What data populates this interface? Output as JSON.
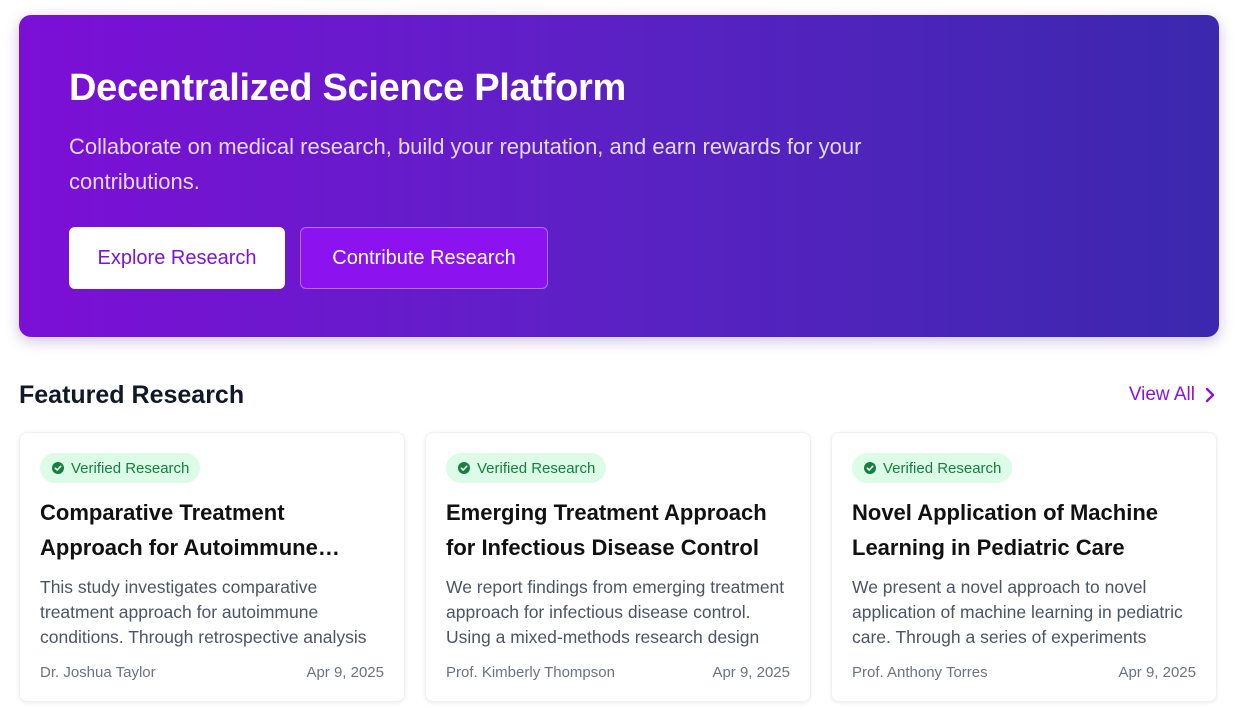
{
  "hero": {
    "title": "Decentralized Science Platform",
    "subtitle": "Collaborate on medical research, build your reputation, and earn rewards for your contributions.",
    "primary_button": "Explore Research",
    "secondary_button": "Contribute Research"
  },
  "featured": {
    "title": "Featured Research",
    "view_all": "View All",
    "view_all_icon": "chevron-right-icon",
    "cards": [
      {
        "badge": "Verified Research",
        "badge_icon": "check-circle-icon",
        "title": "Comparative Treatment Approach for Autoimmune Conditions",
        "description": "This study investigates comparative treatment approach for autoimmune conditions. Through retrospective analysis",
        "author": "Dr. Joshua Taylor",
        "date": "Apr 9, 2025"
      },
      {
        "badge": "Verified Research",
        "badge_icon": "check-circle-icon",
        "title": "Emerging Treatment Approach for Infectious Disease Control",
        "description": "We report findings from emerging treatment approach for infectious disease control. Using a mixed-methods research design",
        "author": "Prof. Kimberly Thompson",
        "date": "Apr 9, 2025"
      },
      {
        "badge": "Verified Research",
        "badge_icon": "check-circle-icon",
        "title": "Novel Application of Machine Learning in Pediatric Care",
        "description": "We present a novel approach to novel application of machine learning in pediatric care. Through a series of experiments",
        "author": "Prof. Anthony Torres",
        "date": "Apr 9, 2025"
      }
    ]
  },
  "colors": {
    "accent": "#8a12e0",
    "hero_gradient_start": "#7c0fd6",
    "hero_gradient_end": "#3b28ad",
    "badge_bg": "#dcfce7",
    "badge_text": "#15803d"
  }
}
